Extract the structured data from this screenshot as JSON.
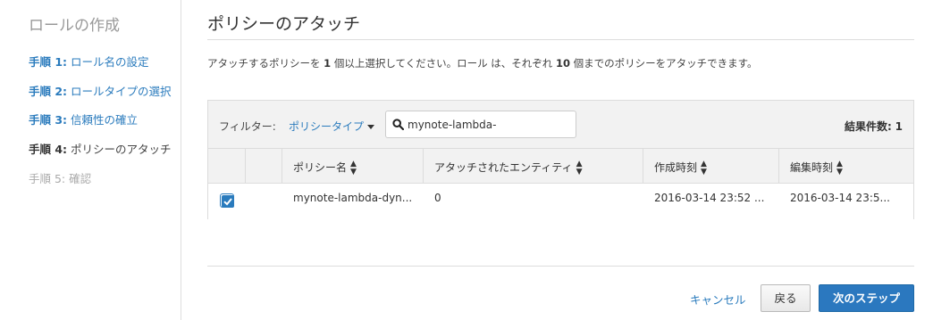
{
  "sidebar": {
    "title": "ロールの作成",
    "steps": [
      {
        "num": "手順 1:",
        "label": "ロール名の設定"
      },
      {
        "num": "手順 2:",
        "label": "ロールタイプの選択"
      },
      {
        "num": "手順 3:",
        "label": "信頼性の確立"
      },
      {
        "num": "手順 4:",
        "label": "ポリシーのアタッチ"
      },
      {
        "num": "手順 5:",
        "label": "確認"
      }
    ]
  },
  "main": {
    "title": "ポリシーのアタッチ",
    "description": {
      "part1": "アタッチするポリシーを ",
      "min": "1",
      "part2": " 個以上選択してください。ロール は、それぞれ ",
      "max": "10",
      "part3": " 個までのポリシーをアタッチできます。"
    }
  },
  "filter": {
    "label": "フィルター:",
    "dropdown": "ポリシータイプ",
    "search_value": "mynote-lambda-",
    "result_label": "結果件数:",
    "result_count": "1"
  },
  "table": {
    "columns": [
      "ポリシー名",
      "アタッチされたエンティティ",
      "作成時刻",
      "編集時刻"
    ],
    "rows": [
      {
        "checked": true,
        "policy_name": "mynote-lambda-dyn...",
        "attached_entities": "0",
        "created": "2016-03-14 23:52 ...",
        "edited": "2016-03-14 23:5..."
      }
    ]
  },
  "footer": {
    "cancel": "キャンセル",
    "back": "戻る",
    "next": "次のステップ"
  },
  "colors": {
    "link": "#2a7bbd",
    "primary_button": "#2b78bf"
  },
  "icons": [
    "search-icon",
    "caret-down-icon",
    "sort-icon",
    "checkbox-checked-icon"
  ]
}
